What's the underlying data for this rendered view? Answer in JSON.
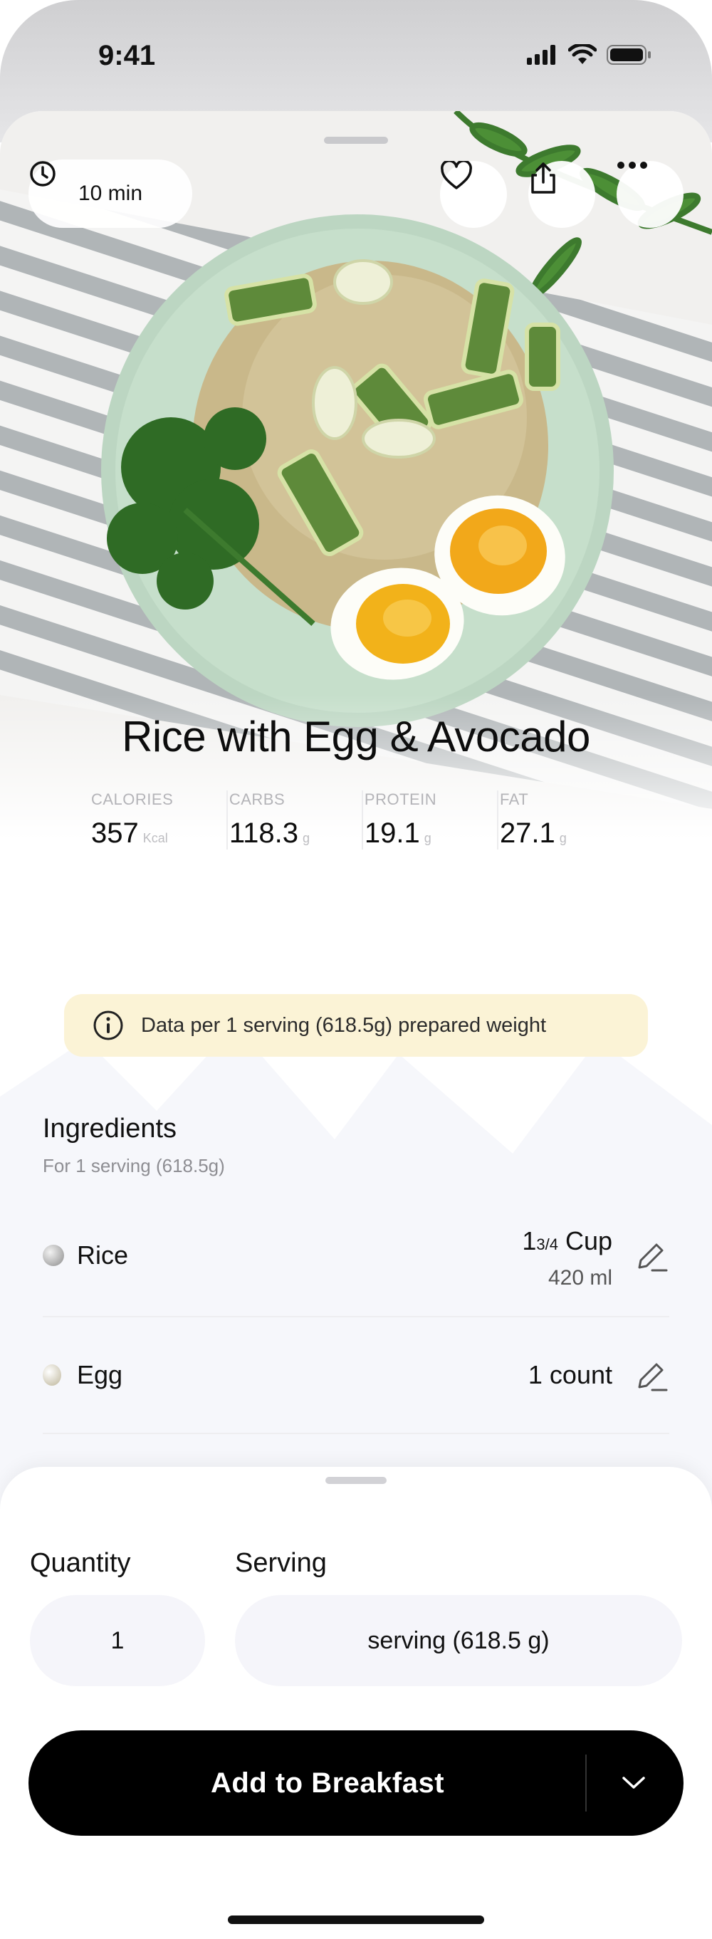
{
  "status_bar": {
    "time": "9:41"
  },
  "hero": {
    "time_chip": "10 min"
  },
  "recipe": {
    "title": "Rice with Egg & Avocado",
    "macros": [
      {
        "label": "CALORIES",
        "value": "357",
        "unit": "Kcal"
      },
      {
        "label": "CARBS",
        "value": "118.3",
        "unit": "g"
      },
      {
        "label": "PROTEIN",
        "value": "19.1",
        "unit": "g"
      },
      {
        "label": "FAT",
        "value": "27.1",
        "unit": "g"
      }
    ],
    "info_banner": "Data per 1 serving (618.5g) prepared weight"
  },
  "ingredients": {
    "title": "Ingredients",
    "subtitle": "For 1 serving (618.5g)",
    "items": [
      {
        "name": "Rice",
        "amount_whole": "1",
        "amount_fraction": "3/4",
        "amount_unit": "Cup",
        "amount_sub": "420 ml"
      },
      {
        "name": "Egg",
        "amount": "1 count"
      }
    ]
  },
  "bottom_sheet": {
    "quantity_label": "Quantity",
    "serving_label": "Serving",
    "quantity_value": "1",
    "serving_value": "serving (618.5 g)",
    "cta_label": "Add to Breakfast"
  },
  "colors": {
    "info_banner_bg": "#fbf3d6",
    "cta_bg": "#000000",
    "pill_bg": "#f5f5fa",
    "plate": "#bcd6c2"
  },
  "icons": [
    "clock-icon",
    "heart-icon",
    "share-icon",
    "more-icon",
    "info-icon",
    "edit-icon",
    "chevron-down-icon",
    "signal-icon",
    "wifi-icon",
    "battery-icon"
  ]
}
